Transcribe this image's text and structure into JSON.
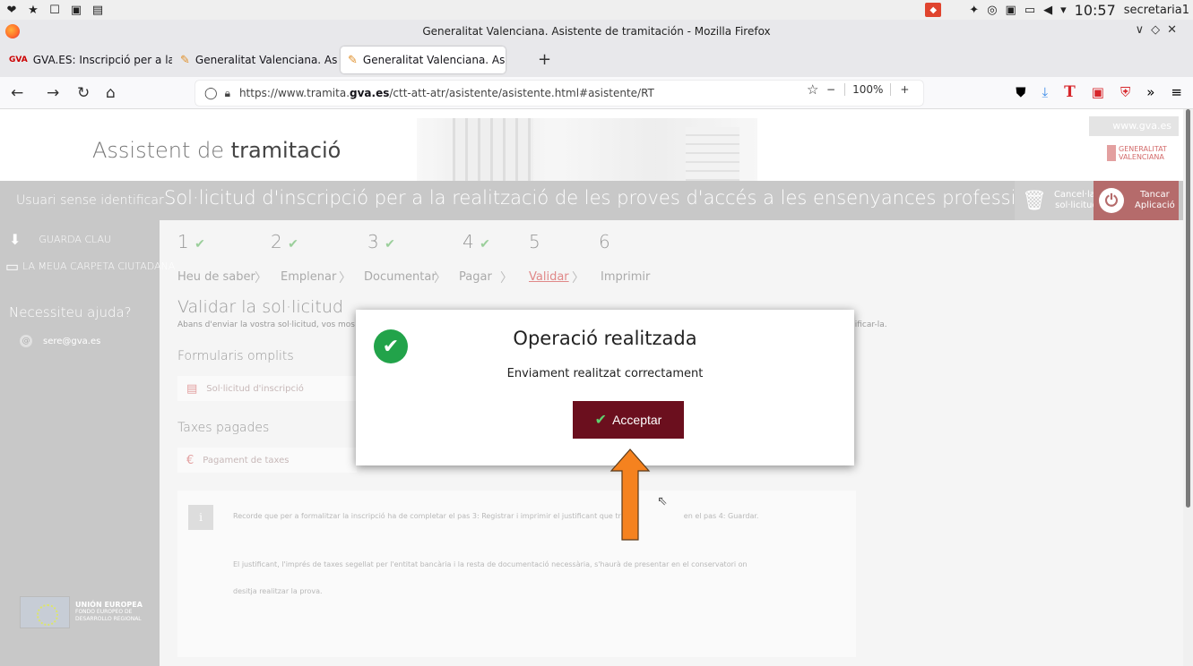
{
  "os": {
    "clock": "10:57",
    "user": "secretaria1"
  },
  "window": {
    "title": "Generalitat Valenciana. Asistente de tramitación - Mozilla Firefox"
  },
  "tabs": [
    {
      "label": "GVA.ES: Inscripció per a la"
    },
    {
      "label": "Generalitat Valenciana. As"
    },
    {
      "label": "Generalitat Valenciana. As"
    }
  ],
  "url": {
    "prefix": "https://www.tramita.",
    "host": "gva.es",
    "path": "/ctt-att-atr/asistente/asistente.html#asistente/RT"
  },
  "zoom": "100%",
  "header": {
    "brand_light": "Assistent de",
    "brand_bold": "tramitació",
    "site": "www.gva.es",
    "logo_line1": "GENERALITAT",
    "logo_line2": "VALENCIANA"
  },
  "bar": {
    "user": "Usuari sense identificar",
    "title": "Sol·licitud d'inscripció per a la realització de les proves d'accés a les ensenyances professionals de música i dansa",
    "cancel_line1": "Cancel·lar",
    "cancel_line2": "sol·licitud",
    "close_line1": "Tancar",
    "close_line2": "Aplicació"
  },
  "sidebar": {
    "save_key": "GUARDA CLAU",
    "folder": "LA MEUA CARPETA CIUTADANA",
    "help": "Necessiteu ajuda?",
    "email": "sere@gva.es",
    "eu_title": "UNIÓN EUROPEA",
    "eu_sub1": "FONDO EUROPEO DE",
    "eu_sub2": "DESARROLLO REGIONAL"
  },
  "steps": [
    {
      "num": "1",
      "label": "Heu de saber"
    },
    {
      "num": "2",
      "label": "Emplenar"
    },
    {
      "num": "3",
      "label": "Documentar"
    },
    {
      "num": "4",
      "label": "Pagar"
    },
    {
      "num": "5",
      "label": "Validar"
    },
    {
      "num": "6",
      "label": "Imprimir"
    }
  ],
  "content": {
    "title": "Validar la sol·licitud",
    "desc_start": "Abans d'enviar la vostra sol·licitud, vos mos",
    "desc_end": "dificar-la.",
    "forms_title": "Formularis omplits",
    "form_item": "Sol·licitud d'inscripció",
    "fees_title": "Taxes pagades",
    "fee_item": "Pagament de taxes",
    "note_line1": "Recorde que per a formalitzar la inscripció ha de completar el pas 3: Registrar i imprimir el justificant que tr",
    "note_line1_end": "en el pas 4: Guardar.",
    "note_line2": "El justificant, l'imprés de taxes segellat per l'entitat bancària i la resta de documentació necessària, s'haurà de presentar en el conservatori on",
    "note_line3": "desitja realitzar la prova."
  },
  "modal": {
    "title": "Operació realitzada",
    "message": "Enviament realitzat correctament",
    "button": "Acceptar"
  },
  "colors": {
    "accept_bg": "#6b0f1e",
    "success": "#22a34a",
    "arrow": "#f5821f",
    "active_step": "#e08888"
  }
}
